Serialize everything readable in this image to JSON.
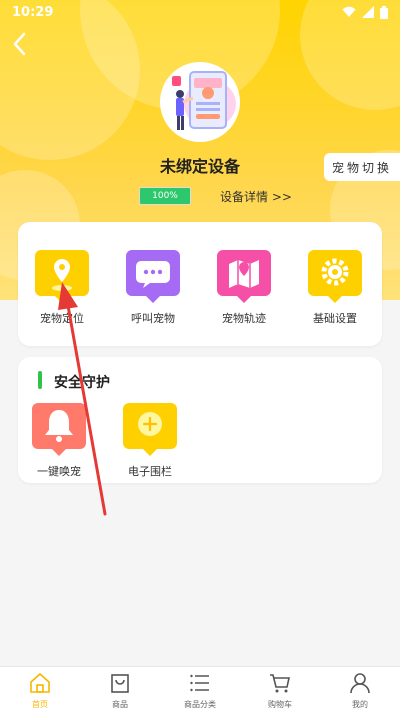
{
  "status": {
    "time": "10:29"
  },
  "device": {
    "title": "未绑定设备",
    "switch_label": "宠物切换",
    "battery_text": "100%",
    "battery_level": 1.0,
    "detail_link": "设备详情 >>"
  },
  "functions": [
    {
      "label": "宠物定位",
      "icon": "location-pin-icon",
      "color": "#ffd000"
    },
    {
      "label": "呼叫宠物",
      "icon": "chat-bubble-icon",
      "color": "#a66bf5"
    },
    {
      "label": "宠物轨迹",
      "icon": "map-icon",
      "color": "#f54fa8"
    },
    {
      "label": "基础设置",
      "icon": "gear-icon",
      "color": "#ffd000"
    }
  ],
  "safety": {
    "title": "安全守护",
    "items": [
      {
        "label": "一键唤宠",
        "icon": "bell-icon",
        "color": "#ff7a6a"
      },
      {
        "label": "电子围栏",
        "icon": "fence-plus-icon",
        "color": "#ffd000"
      }
    ]
  },
  "nav": [
    {
      "label": "首页",
      "icon": "home-icon",
      "active": true
    },
    {
      "label": "商品",
      "icon": "shopping-bag-icon"
    },
    {
      "label": "商品分类",
      "icon": "list-icon"
    },
    {
      "label": "购物车",
      "icon": "cart-icon"
    },
    {
      "label": "我的",
      "icon": "person-icon"
    }
  ],
  "colors": {
    "accent": "#ffd400",
    "battery": "#2dc76d",
    "annotation_arrow": "#e53935"
  }
}
